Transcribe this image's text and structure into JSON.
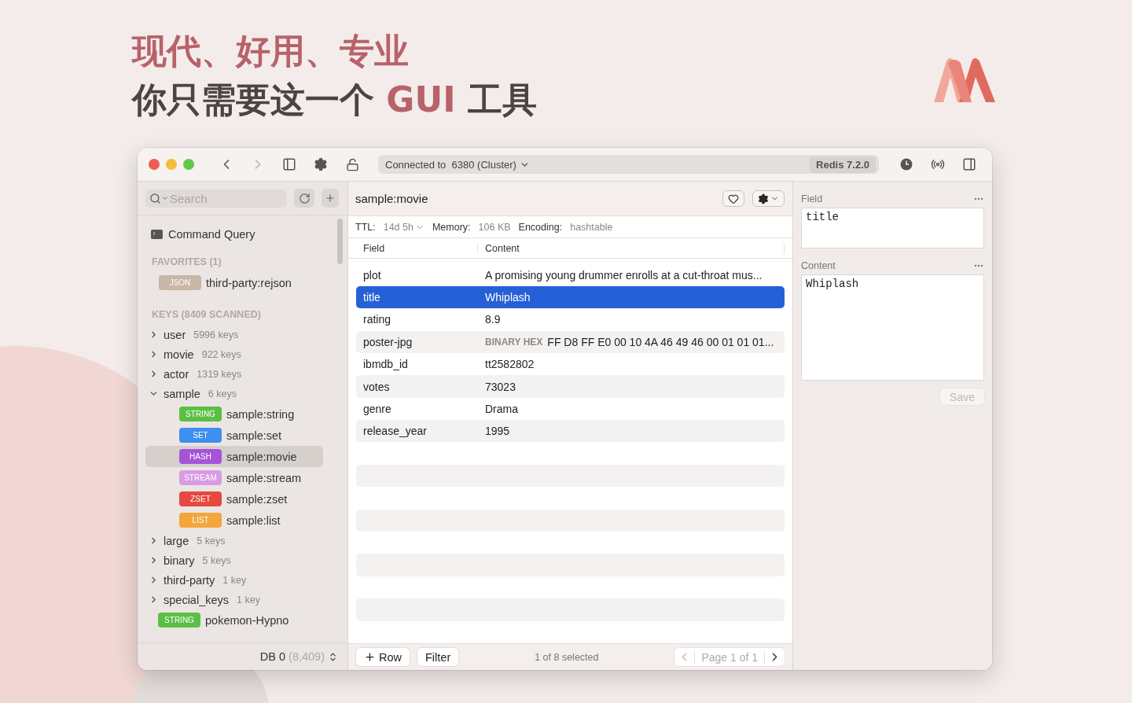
{
  "headline": {
    "line1": "现代、好用、专业",
    "line2": [
      {
        "text": "你只需要这一个 ",
        "accent": false
      },
      {
        "text": "GUI",
        "accent": true
      },
      {
        "text": " 工具",
        "accent": false
      }
    ]
  },
  "toolbar": {
    "back_disabled": false,
    "forward_disabled": true,
    "connection": "Connected to  6380 (Cluster)",
    "server": "Redis 7.2.0"
  },
  "sidebar": {
    "search": {
      "placeholder": "Search"
    },
    "command_query": "Command Query",
    "favorites": {
      "title": "FAVORITES (1)",
      "items": [
        {
          "type": "JSON",
          "color": "#c8b6a6",
          "name": "third-party:rejson",
          "selected": false
        }
      ]
    },
    "keys_title": "KEYS (8409 SCANNED)",
    "keys": [
      {
        "kind": "group",
        "name": "user",
        "count": "5996 keys",
        "expanded": false
      },
      {
        "kind": "group",
        "name": "movie",
        "count": "922 keys",
        "expanded": false
      },
      {
        "kind": "group",
        "name": "actor",
        "count": "1319 keys",
        "expanded": false
      },
      {
        "kind": "group",
        "name": "sample",
        "count": "6 keys",
        "expanded": true,
        "children": [
          {
            "kind": "key",
            "type": "STRING",
            "color": "#5cbf45",
            "name": "sample:string",
            "selected": false
          },
          {
            "kind": "key",
            "type": "SET",
            "color": "#3d8ff0",
            "name": "sample:set",
            "selected": false
          },
          {
            "kind": "key",
            "type": "HASH",
            "color": "#a653d9",
            "name": "sample:movie",
            "selected": true
          },
          {
            "kind": "key",
            "type": "STREAM",
            "color": "#d99be3",
            "name": "sample:stream",
            "selected": false
          },
          {
            "kind": "key",
            "type": "ZSET",
            "color": "#e5493f",
            "name": "sample:zset",
            "selected": false
          },
          {
            "kind": "key",
            "type": "LIST",
            "color": "#f2a63c",
            "name": "sample:list",
            "selected": false
          }
        ]
      },
      {
        "kind": "group",
        "name": "large",
        "count": "5 keys",
        "expanded": false
      },
      {
        "kind": "group",
        "name": "binary",
        "count": "5 keys",
        "expanded": false
      },
      {
        "kind": "group",
        "name": "third-party",
        "count": "1 key",
        "expanded": false
      },
      {
        "kind": "group",
        "name": "special_keys",
        "count": "1 key",
        "expanded": false
      },
      {
        "kind": "key",
        "type": "STRING",
        "color": "#5cbf45",
        "name": "pokemon-Hypno",
        "selected": false
      }
    ],
    "db": "DB 0",
    "db_count": "(8,409)"
  },
  "key_view": {
    "name": "sample:movie",
    "ttl_label": "TTL:",
    "ttl": "14d 5h",
    "memory_label": "Memory:",
    "memory": "106 KB",
    "encoding_label": "Encoding:",
    "encoding": "hashtable"
  },
  "table": {
    "columns": [
      "Field",
      "Content"
    ],
    "rows": [
      {
        "field": "plot",
        "content": "A promising young drummer enrolls at a cut-throat mus...",
        "selected": false
      },
      {
        "field": "title",
        "content": "Whiplash",
        "selected": true
      },
      {
        "field": "rating",
        "content": "8.9",
        "selected": false
      },
      {
        "field": "poster-jpg",
        "tag": "BINARY HEX",
        "content": "FF D8 FF E0 00 10 4A 46 49 46 00 01 01 01...",
        "selected": false
      },
      {
        "field": "ibmdb_id",
        "content": "tt2582802",
        "selected": false
      },
      {
        "field": "votes",
        "content": "73023",
        "selected": false
      },
      {
        "field": "genre",
        "content": "Drama",
        "selected": false
      },
      {
        "field": "release_year",
        "content": "1995",
        "selected": false
      }
    ]
  },
  "footer": {
    "add_row": "Row",
    "filter": "Filter",
    "status": "1 of 8 selected",
    "page": "Page 1 of 1",
    "prev_disabled": true,
    "next_disabled": false
  },
  "inspector": {
    "field_label": "Field",
    "field_value": "title",
    "content_label": "Content",
    "content_value": "Whiplash",
    "save": "Save",
    "save_disabled": true
  }
}
